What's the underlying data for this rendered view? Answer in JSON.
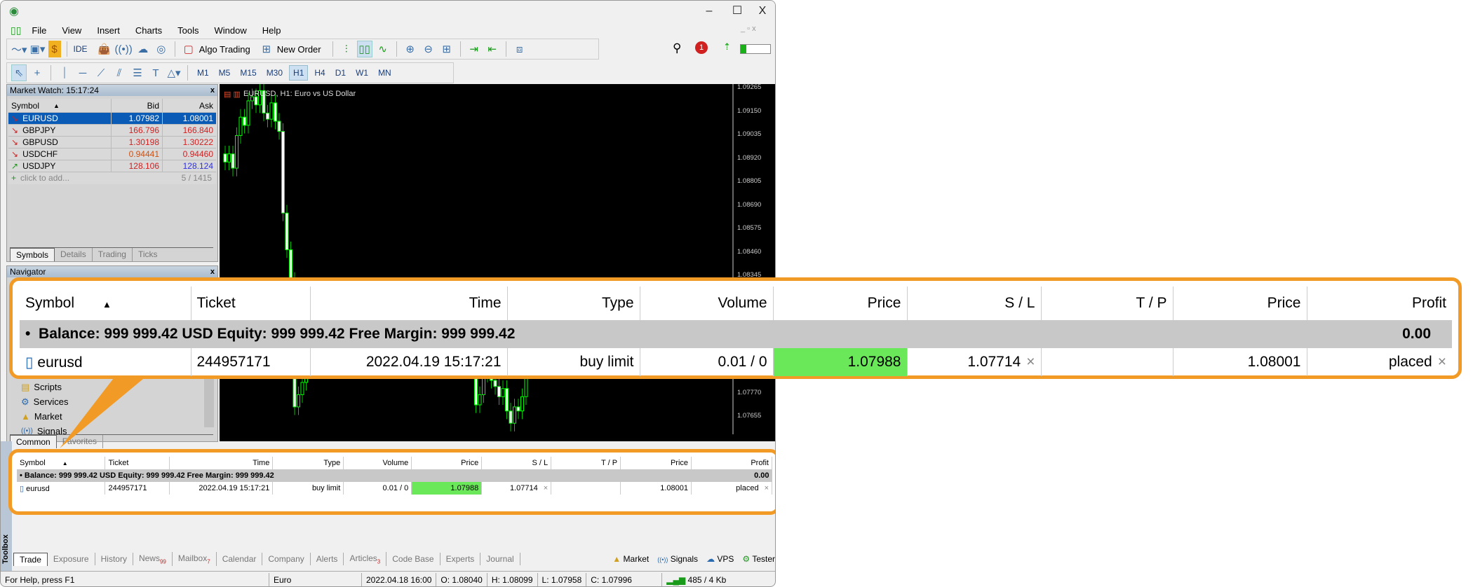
{
  "window": {
    "controls": [
      "–",
      "☐",
      "X"
    ]
  },
  "menu": [
    "File",
    "View",
    "Insert",
    "Charts",
    "Tools",
    "Window",
    "Help"
  ],
  "toolbar": {
    "ide": "IDE",
    "algo_trading": "Algo Trading",
    "new_order": "New Order",
    "notifications_count": "1"
  },
  "timeframes": [
    "M1",
    "M5",
    "M15",
    "M30",
    "H1",
    "H4",
    "D1",
    "W1",
    "MN"
  ],
  "active_timeframe": "H1",
  "market_watch": {
    "title": "Market Watch: 15:17:24",
    "headers": [
      "Symbol",
      "Bid",
      "Ask"
    ],
    "rows": [
      {
        "symbol": "EURUSD",
        "bid": "1.07982",
        "ask": "1.08001",
        "dir": "down",
        "selected": true
      },
      {
        "symbol": "GBPJPY",
        "bid": "166.796",
        "ask": "166.840",
        "dir": "down"
      },
      {
        "symbol": "GBPUSD",
        "bid": "1.30198",
        "ask": "1.30222",
        "dir": "down"
      },
      {
        "symbol": "USDCHF",
        "bid": "0.94441",
        "ask": "0.94460",
        "dir": "down"
      },
      {
        "symbol": "USDJPY",
        "bid": "128.106",
        "ask": "128.124",
        "dir": "up"
      }
    ],
    "add": "click to add...",
    "count": "5 / 1415",
    "tabs": [
      "Symbols",
      "Details",
      "Trading",
      "Ticks"
    ]
  },
  "navigator": {
    "title": "Navigator",
    "items": [
      "Scripts",
      "Services",
      "Market",
      "Signals"
    ],
    "tabs": [
      "Common",
      "Favorites"
    ]
  },
  "chart": {
    "title": "EURUSD, H1:  Euro vs US Dollar",
    "price_ticks": [
      "1.09265",
      "1.09150",
      "1.09035",
      "1.08920",
      "1.08805",
      "1.08690",
      "1.08575",
      "1.08460",
      "1.08345",
      "1.07770",
      "1.07655"
    ],
    "closes": [
      1.089,
      1.0894,
      1.0887,
      1.0903,
      1.0912,
      1.0908,
      1.092,
      1.0922,
      1.0918,
      1.0925,
      1.0914,
      1.0911,
      1.0919,
      1.091,
      1.0905,
      1.0865,
      1.0847,
      1.0832,
      1.077,
      1.0776,
      1.0782,
      1.0795,
      1.0801,
      1.0808,
      1.0812,
      1.0805,
      1.08,
      1.0811,
      1.0818,
      1.0822,
      1.0815,
      1.0808,
      1.0812,
      1.0806,
      1.0798,
      1.0802,
      1.081,
      1.0815,
      1.0809,
      1.0801,
      1.0796,
      1.0805,
      1.0812,
      1.0808,
      1.0799,
      1.0795,
      1.0803,
      1.081,
      1.0806,
      1.08,
      1.0797,
      1.0804,
      1.0808,
      1.0802,
      1.0796,
      1.0792,
      1.0798,
      1.0803,
      1.0799,
      1.0794,
      1.079,
      1.0796,
      1.08,
      1.0795,
      1.079,
      1.0771,
      1.0776,
      1.079,
      1.0786,
      1.0783,
      1.078,
      1.0775,
      1.0779,
      1.0768,
      1.0762,
      1.077,
      1.0768,
      1.0775,
      1.079,
      1.08
    ],
    "bull_color": "#00ff00",
    "bear_color": "#00c000"
  },
  "trade": {
    "headers": [
      "Symbol",
      "Ticket",
      "Time",
      "Type",
      "Volume",
      "Price",
      "S / L",
      "T / P",
      "Price",
      "Profit"
    ],
    "balance": "Balance: 999 999.42 USD  Equity: 999 999.42  Free Margin: 999 999.42",
    "balance_profit": "0.00",
    "row": {
      "symbol": "eurusd",
      "ticket": "244957171",
      "time": "2022.04.19 15:17:21",
      "type": "buy limit",
      "volume": "0.01 / 0",
      "price": "1.07988",
      "sl": "1.07714",
      "tp": "",
      "cur_price": "1.08001",
      "profit": "placed"
    },
    "highlight_color": "#6ae85a",
    "callout_color": "#f29a26"
  },
  "toolbox": {
    "label": "Toolbox",
    "tabs": [
      {
        "l": "Trade"
      },
      {
        "l": "Exposure"
      },
      {
        "l": "History"
      },
      {
        "l": "News",
        "b": "99"
      },
      {
        "l": "Mailbox",
        "b": "7"
      },
      {
        "l": "Calendar"
      },
      {
        "l": "Company"
      },
      {
        "l": "Alerts"
      },
      {
        "l": "Articles",
        "b": "3"
      },
      {
        "l": "Code Base"
      },
      {
        "l": "Experts"
      },
      {
        "l": "Journal"
      }
    ],
    "right": [
      "Market",
      "Signals",
      "VPS",
      "Tester"
    ]
  },
  "status": {
    "help": "For Help, press F1",
    "profile": "Euro",
    "time": "2022.04.18 16:00",
    "o": "O: 1.08040",
    "h": "H: 1.08099",
    "l": "L: 1.07958",
    "c": "C: 1.07996",
    "traffic": "485 / 4 Kb"
  }
}
